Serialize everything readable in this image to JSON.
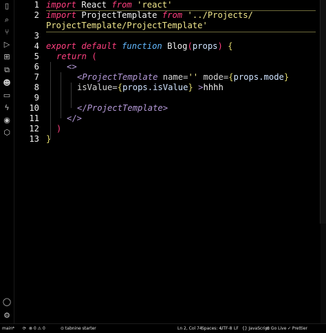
{
  "activity_bar": {
    "icons": [
      "files-icon",
      "search-icon",
      "source-control-icon",
      "run-debug-icon",
      "extensions-icon",
      "remote-explorer-icon",
      "alien-icon",
      "folder-icon",
      "lightning-icon",
      "assistant-icon",
      "hexagon-icon",
      "account-icon",
      "gear-icon"
    ]
  },
  "editor": {
    "line_numbers": [
      "1",
      "2",
      "3",
      "4",
      "5",
      "6",
      "7",
      "8",
      "9",
      "10",
      "11",
      "12",
      "13"
    ],
    "lines": [
      {
        "parts": [
          [
            "kw-i",
            "import"
          ],
          [
            "fn",
            " React "
          ],
          [
            "kw-i",
            "from"
          ],
          [
            "str",
            " 'react'"
          ]
        ]
      },
      {
        "parts": [
          [
            "kw-i",
            "import"
          ],
          [
            "fn",
            " ProjectTemplate "
          ],
          [
            "kw-i",
            "from"
          ],
          [
            "str",
            " '../Projects/"
          ]
        ]
      },
      {
        "parts": [
          [
            "str",
            "ProjectTemplate/ProjectTemplate'"
          ]
        ]
      },
      {
        "parts": []
      },
      {
        "parts": [
          [
            "kw-i",
            "export"
          ],
          [
            "kw-i",
            " default"
          ],
          [
            "kw-b",
            " function"
          ],
          [
            "fn",
            " Blog"
          ],
          [
            "paren",
            "("
          ],
          [
            "var",
            "props"
          ],
          [
            "paren",
            ")"
          ],
          [
            "brace",
            " {"
          ]
        ]
      },
      {
        "parts": [
          [
            "kw-i",
            "return"
          ],
          [
            "paren",
            " ("
          ]
        ]
      },
      {
        "parts": [
          [
            "tag",
            "<>"
          ]
        ]
      },
      {
        "parts": [
          [
            "tag",
            "<"
          ],
          [
            "tag-i",
            "ProjectTemplate"
          ],
          [
            "attr",
            " name"
          ],
          [
            "punc",
            "="
          ],
          [
            "str",
            "''"
          ],
          [
            "attr",
            " mode"
          ],
          [
            "punc",
            "="
          ],
          [
            "brace",
            "{"
          ],
          [
            "var",
            "props.mode"
          ],
          [
            "brace",
            "}"
          ]
        ]
      },
      {
        "parts": [
          [
            "attr",
            "isValue"
          ],
          [
            "punc",
            "="
          ],
          [
            "brace",
            "{"
          ],
          [
            "var",
            "props.isValue"
          ],
          [
            "brace",
            "}"
          ],
          [
            "tag",
            " >"
          ],
          [
            "fn",
            "hhhh"
          ]
        ]
      },
      {
        "parts": []
      },
      {
        "parts": [
          [
            "tag",
            "</"
          ],
          [
            "tag-i",
            "ProjectTemplate"
          ],
          [
            "tag",
            ">"
          ]
        ]
      },
      {
        "parts": [
          [
            "tag",
            "</>"
          ]
        ]
      },
      {
        "parts": [
          [
            "paren",
            ")"
          ]
        ]
      },
      {
        "parts": [
          [
            "brace",
            "}"
          ]
        ]
      },
      {
        "parts": []
      }
    ]
  },
  "status_bar": {
    "branch": "main*",
    "sync": "⟳",
    "problems": "⊗ 0 ⚠ 0",
    "tabnine": "⊙ tabnine starter",
    "position": "Ln 2, Col 74",
    "spaces": "Spaces: 4",
    "encoding": "UTF-8",
    "eol": "LF",
    "language": "{} JavaScript",
    "golive": "⊙ Go Live",
    "prettier": "✓ Prettier"
  }
}
